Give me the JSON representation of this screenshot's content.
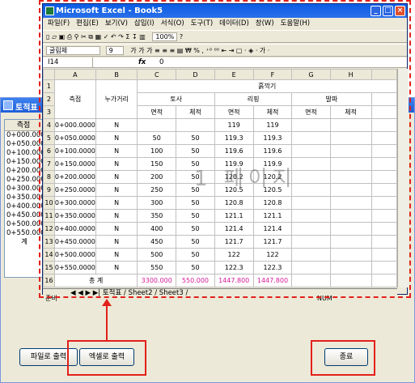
{
  "background_window": {
    "title": "토적표",
    "list_header": "측점",
    "list_items": [
      "0+000.000",
      "0+050.000",
      "0+100.000",
      "0+150.000",
      "0+200.000",
      "0+250.000",
      "0+300.000",
      "0+350.000",
      "0+400.000",
      "0+450.000",
      "0+500.000",
      "0+550.000",
      "계"
    ],
    "buttons": {
      "file_export": "파일로 출력",
      "excel_export": "엑셀로 출력",
      "close": "종료"
    }
  },
  "excel": {
    "title": "Microsoft Excel - Book5",
    "menu": [
      "파일(F)",
      "편집(E)",
      "보기(V)",
      "삽입(I)",
      "서식(O)",
      "도구(T)",
      "데이터(D)",
      "창(W)",
      "도움말(H)"
    ],
    "toolbar1_zoom": "100%",
    "font_name": "굴림체",
    "font_size": "9",
    "toolbar2_items": "가  가  가   ≡  ≡  ≡  ▤   ₩  %  ,  ⁺⁰  ⁰⁰  ⇤  ⇥   ▢ ·  ◈ ·  가 ·",
    "name_box": "I14",
    "fx": "fx",
    "formula_value": "0",
    "columns": [
      "A",
      "B",
      "C",
      "D",
      "E",
      "F",
      "G",
      "H"
    ],
    "rows": [
      "1",
      "2",
      "3",
      "4",
      "5",
      "6",
      "7",
      "8",
      "9",
      "10",
      "11",
      "12",
      "13",
      "14",
      "15",
      "16"
    ],
    "header": {
      "station": "측점",
      "cumdist": "누가거리",
      "borrow": "흙깍기",
      "soil": "토사",
      "rip": "리핑",
      "blast": "발파",
      "area": "면적",
      "volume": "체적"
    },
    "data_rows": [
      [
        "0+000.0000",
        "N",
        "",
        "",
        "119",
        "119"
      ],
      [
        "0+050.0000",
        "N",
        "50",
        "50",
        "119.3",
        "119.3"
      ],
      [
        "0+100.0000",
        "N",
        "100",
        "50",
        "119.6",
        "119.6"
      ],
      [
        "0+150.0000",
        "N",
        "150",
        "50",
        "119.9",
        "119.9"
      ],
      [
        "0+200.0000",
        "N",
        "200",
        "50",
        "120.2",
        "120.2"
      ],
      [
        "0+250.0000",
        "N",
        "250",
        "50",
        "120.5",
        "120.5"
      ],
      [
        "0+300.0000",
        "N",
        "300",
        "50",
        "120.8",
        "120.8"
      ],
      [
        "0+350.0000",
        "N",
        "350",
        "50",
        "121.1",
        "121.1"
      ],
      [
        "0+400.0000",
        "N",
        "400",
        "50",
        "121.4",
        "121.4"
      ],
      [
        "0+450.0000",
        "N",
        "450",
        "50",
        "121.7",
        "121.7"
      ],
      [
        "0+500.0000",
        "N",
        "500",
        "50",
        "122",
        "122"
      ],
      [
        "0+550.0000",
        "N",
        "550",
        "50",
        "122.3",
        "122.3"
      ]
    ],
    "total": {
      "label": "총 계",
      "c": "3300.000",
      "d": "550.000",
      "e": "1447.800",
      "f": "1447.800"
    },
    "sheet_tabs": "◀ ◀ ▶ ▶| 토적표 / Sheet2 / Sheet3 /",
    "status_left": "준비",
    "status_right": "NUM",
    "watermark": "1 페이지"
  },
  "colors": {
    "highlight": "#e3201a",
    "total_text": "#d61c9a",
    "title_bar": "#0a5ce6"
  }
}
